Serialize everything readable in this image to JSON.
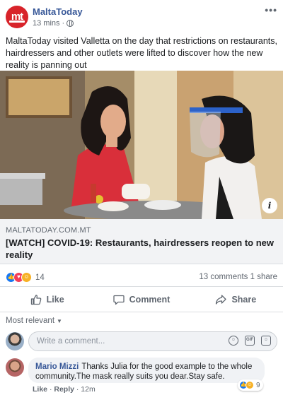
{
  "post": {
    "page_name": "MaltaToday",
    "logo_text": "mt",
    "time": "13 mins",
    "separator": "·",
    "text": "MaltaToday visited Valletta on the day that restrictions on restaurants, hairdressers and other outlets were lifted to discover how the new reality is panning out"
  },
  "link": {
    "domain": "MALTATODAY.COM.MT",
    "title": "[WATCH] COVID-19: Restaurants, hairdressers reopen to new reality",
    "info_glyph": "i"
  },
  "stats": {
    "reaction_count": "14",
    "comments": "13 comments",
    "shares": "1 share"
  },
  "actions": {
    "like": "Like",
    "comment": "Comment",
    "share": "Share"
  },
  "comments_section": {
    "sort_label": "Most relevant",
    "input_placeholder": "Write a comment...",
    "comment": {
      "author": "Mario Mizzi",
      "text": "Thanks Julia for the good example to the whole community.The mask really suits you dear.Stay safe.",
      "reaction_count": "9",
      "like_label": "Like",
      "reply_label": "Reply",
      "time": "12m",
      "dot": "·"
    }
  },
  "colors": {
    "brand_red": "#d8232a",
    "link_blue": "#385898",
    "like_blue": "#1877f2",
    "love_red": "#f33e58",
    "haha_yellow": "#f7b125"
  }
}
